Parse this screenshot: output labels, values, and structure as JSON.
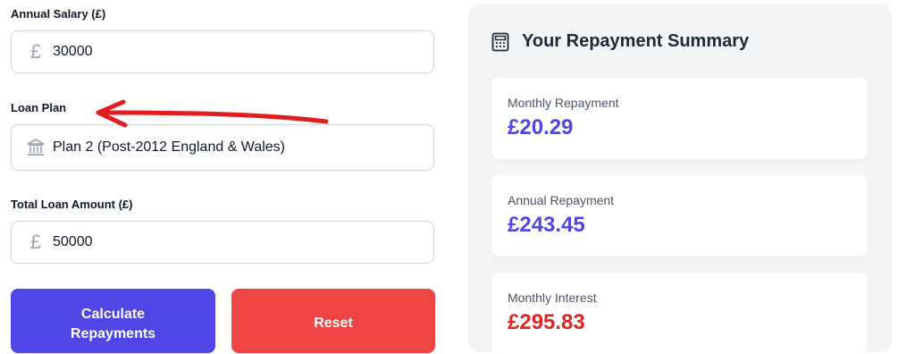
{
  "form": {
    "salary": {
      "label": "Annual Salary (£)",
      "icon": "pound-icon",
      "icon_glyph": "£",
      "value": "30000"
    },
    "plan": {
      "label": "Loan Plan",
      "icon": "bank-icon",
      "value": "Plan 2 (Post-2012 England & Wales)"
    },
    "loan": {
      "label": "Total Loan Amount (£)",
      "icon": "pound-icon",
      "icon_glyph": "£",
      "value": "50000"
    },
    "buttons": {
      "calculate_line1": "Calculate",
      "calculate_line2": "Repayments",
      "reset": "Reset"
    }
  },
  "summary": {
    "title": "Your Repayment Summary",
    "icon": "calculator-icon",
    "cards": [
      {
        "label": "Monthly Repayment",
        "value": "£20.29"
      },
      {
        "label": "Annual Repayment",
        "value": "£243.45"
      },
      {
        "label": "Monthly Interest",
        "value": "£295.83"
      }
    ]
  },
  "colors": {
    "primary": "#4f46e5",
    "danger": "#ef4444",
    "interest": "#dc2626",
    "annotation_arrow": "#e11d1d"
  }
}
